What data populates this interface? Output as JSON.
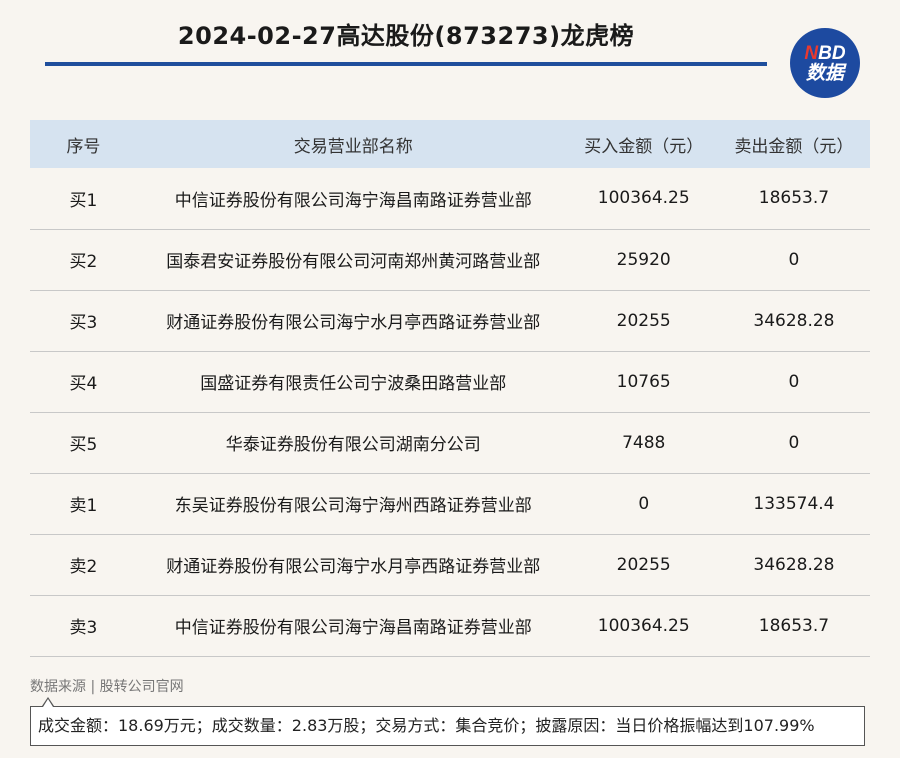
{
  "header": {
    "title": "2024-02-27高达股份(873273)龙虎榜",
    "logo_line1_n": "N",
    "logo_line1_rest": "BD",
    "logo_line2": "数据"
  },
  "table": {
    "columns": [
      "序号",
      "交易营业部名称",
      "买入金额（元）",
      "卖出金额（元）"
    ],
    "rows": [
      [
        "买1",
        "中信证券股份有限公司海宁海昌南路证券营业部",
        "100364.25",
        "18653.7"
      ],
      [
        "买2",
        "国泰君安证券股份有限公司河南郑州黄河路营业部",
        "25920",
        "0"
      ],
      [
        "买3",
        "财通证券股份有限公司海宁水月亭西路证券营业部",
        "20255",
        "34628.28"
      ],
      [
        "买4",
        "国盛证券有限责任公司宁波桑田路营业部",
        "10765",
        "0"
      ],
      [
        "买5",
        "华泰证券股份有限公司湖南分公司",
        "7488",
        "0"
      ],
      [
        "卖1",
        "东吴证券股份有限公司海宁海州西路证券营业部",
        "0",
        "133574.4"
      ],
      [
        "卖2",
        "财通证券股份有限公司海宁水月亭西路证券营业部",
        "20255",
        "34628.28"
      ],
      [
        "卖3",
        "中信证券股份有限公司海宁海昌南路证券营业部",
        "100364.25",
        "18653.7"
      ]
    ]
  },
  "footer": {
    "source": "数据来源 | 股转公司官网",
    "note": "成交金额：18.69万元；成交数量：2.83万股；交易方式：集合竞价；披露原因：当日价格振幅达到107.99%"
  },
  "colors": {
    "accent_blue": "#1f4e9c",
    "header_bg": "#d6e3f0",
    "logo_red": "#e8392f"
  }
}
